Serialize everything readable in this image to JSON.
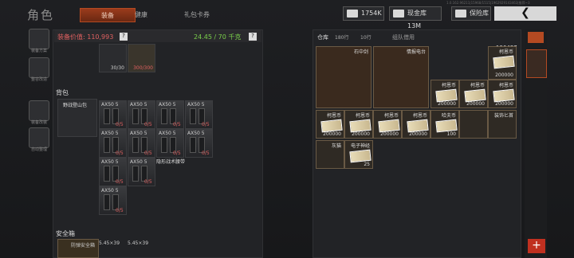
{
  "header": {
    "title": "角色",
    "tabs": [
      "装备",
      "健康",
      "礼包卡券"
    ],
    "money": "1754K",
    "coffer": "现金库 13M",
    "vault": "保险库",
    "version": "1.0.162.96211|15968/1515|1962929143463|推荐~3"
  },
  "sidebar": {
    "items": [
      "装备方案",
      "整容改造",
      "装备改装",
      "自动整理"
    ]
  },
  "equipment": {
    "value_label": "装备价值: 110,993",
    "weight": "24.45 / 70 千克",
    "row_counts": [
      "30/30",
      "300/300"
    ]
  },
  "backpack": {
    "title": "背包",
    "bag_name": "野战登山包",
    "ammo_label": "AX50 5",
    "ammo_count": "0/5",
    "extra_item": "隐形战术腰带"
  },
  "safebox": {
    "title": "安全箱",
    "name": "防弹安全箱",
    "ammo": [
      "5.45×39",
      "5.45×39"
    ]
  },
  "storage": {
    "tabs": [
      "仓库",
      "组队借用"
    ],
    "slot_a": "180行",
    "slot_b": "10行",
    "code": "196427",
    "items": [
      {
        "name": "石中剑"
      },
      {
        "name": "情报电台"
      },
      {
        "name": "柯恩币",
        "qty": "200000"
      },
      {
        "name": "柯恩币",
        "qty": "200000"
      },
      {
        "name": "柯恩币",
        "qty": "200000"
      },
      {
        "name": "柯恩币",
        "qty": "200000"
      },
      {
        "name": "柯恩币",
        "qty": "200000"
      },
      {
        "name": "柯恩币",
        "qty": "200000"
      },
      {
        "name": "柯恩币",
        "qty": "200000"
      },
      {
        "name": "柯恩币",
        "qty": "200000"
      },
      {
        "name": "哈夫币",
        "qty": "100"
      },
      {
        "name": ""
      },
      {
        "name": ""
      },
      {
        "name": "装饰匕首"
      },
      {
        "name": "灰猫"
      },
      {
        "name": "电子神经",
        "qty": "25"
      }
    ]
  },
  "colors": {
    "accent": "#b44a22",
    "red": "#e06060",
    "green": "#7ad04a"
  }
}
